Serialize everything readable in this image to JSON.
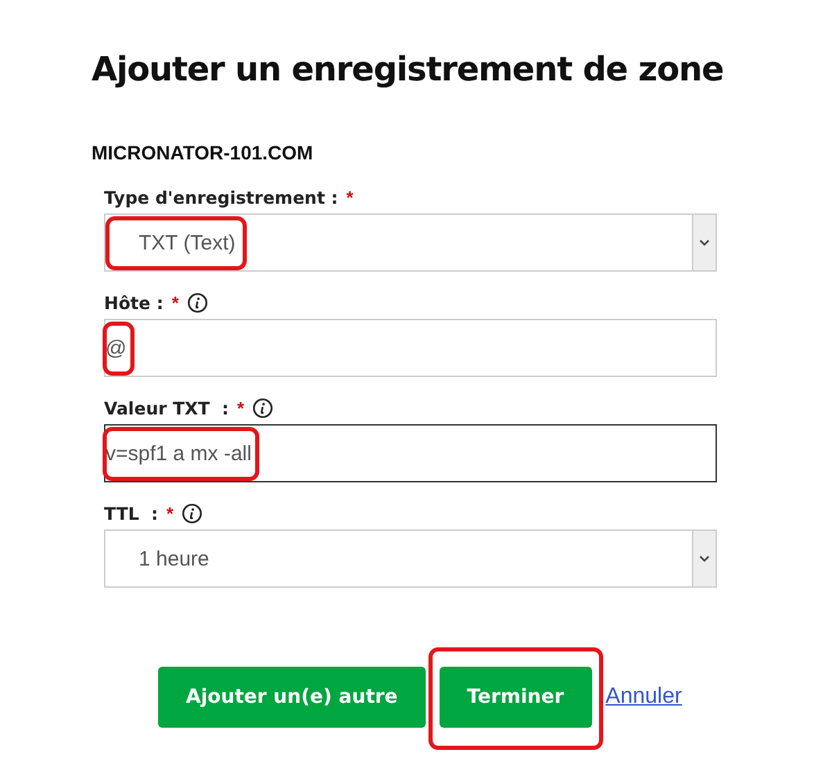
{
  "title": "Ajouter un enregistrement de zone",
  "domain": "MICRONATOR-101.COM",
  "fields": [
    {
      "kind": "select",
      "label": "Type d'enregistrement :",
      "required_mark": "*",
      "info": false,
      "value": "TXT (Text)",
      "focused": false,
      "highlighted": true
    },
    {
      "kind": "input",
      "label": "Hôte :",
      "required_mark": "*",
      "info": true,
      "value": "@",
      "focused": false,
      "highlighted": true
    },
    {
      "kind": "input",
      "label": "Valeur TXT  :",
      "required_mark": "*",
      "info": true,
      "value": "v=spf1 a mx -all",
      "focused": true,
      "highlighted": true
    },
    {
      "kind": "select",
      "label": "TTL  :",
      "required_mark": "*",
      "info": true,
      "value": "1 heure",
      "focused": false,
      "highlighted": false
    }
  ],
  "buttons": [
    {
      "kind": "button",
      "label": "Ajouter un(e) autre",
      "highlighted": false
    },
    {
      "kind": "button",
      "label": "Terminer",
      "highlighted": true
    },
    {
      "kind": "link",
      "label": "Annuler",
      "highlighted": false
    }
  ]
}
